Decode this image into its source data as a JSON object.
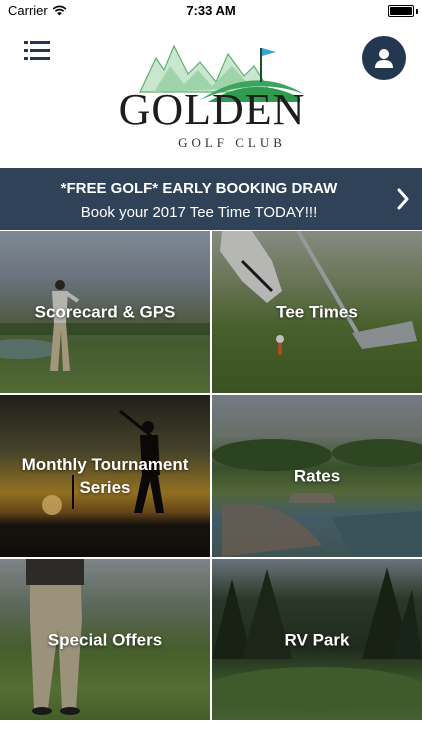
{
  "status_bar": {
    "carrier": "Carrier",
    "time": "7:33 AM"
  },
  "header": {
    "logo": {
      "name": "GOLDEN",
      "subtitle": "GOLF CLUB"
    },
    "menu_icon": "list-menu-icon",
    "user_icon": "user-icon"
  },
  "banner": {
    "title": "*FREE GOLF* EARLY BOOKING DRAW",
    "subtitle": "Book your 2017 Tee Time TODAY!!!",
    "icon": "chevron-right-icon"
  },
  "tiles": [
    {
      "label": "Scorecard & GPS"
    },
    {
      "label": "Tee Times"
    },
    {
      "label": "Monthly Tournament Series"
    },
    {
      "label": "Rates"
    },
    {
      "label": "Special Offers"
    },
    {
      "label": "RV Park"
    }
  ],
  "colors": {
    "navy": "#233750",
    "banner": "#2f4258",
    "logo_green": "#3aa55d",
    "flag_blue": "#39a3d9"
  }
}
